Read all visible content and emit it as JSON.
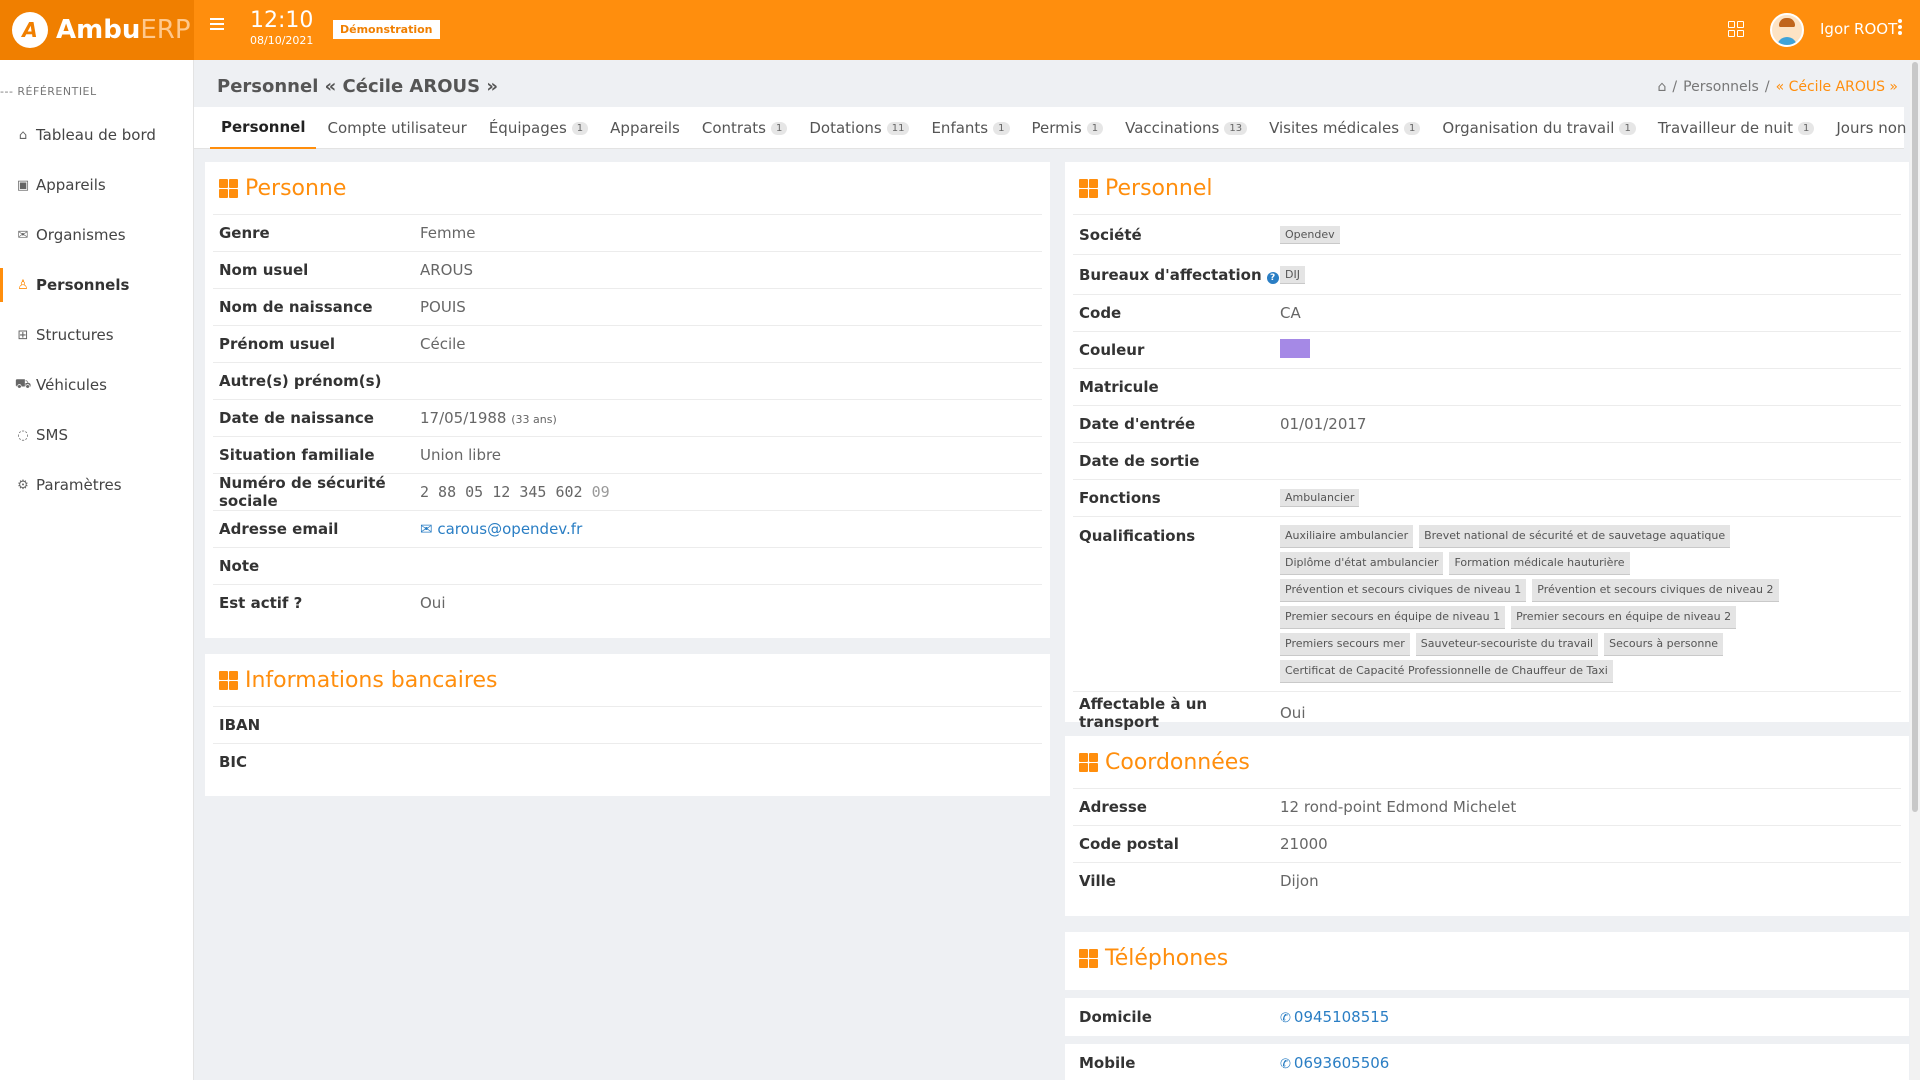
{
  "app": {
    "logo_letter": "A",
    "logo_bold": "Ambu",
    "logo_light": "ERP",
    "time": "12:10",
    "date": "08/10/2021",
    "demo_badge": "Démonstration",
    "user_name": "Igor ROOT",
    "accent_color": "#ff8e0d"
  },
  "sidebar": {
    "heading": "--- RÉFÉRENTIEL",
    "items": [
      {
        "label": "Tableau de bord",
        "icon": "home-icon"
      },
      {
        "label": "Appareils",
        "icon": "device-icon"
      },
      {
        "label": "Organismes",
        "icon": "inbox-icon"
      },
      {
        "label": "Personnels",
        "icon": "people-icon"
      },
      {
        "label": "Structures",
        "icon": "sitemap-icon"
      },
      {
        "label": "Véhicules",
        "icon": "car-icon"
      },
      {
        "label": "SMS",
        "icon": "chat-icon"
      },
      {
        "label": "Paramètres",
        "icon": "gear-icon"
      }
    ]
  },
  "page": {
    "title": "Personnel « Cécile AROUS »",
    "breadcrumb": [
      "Personnels",
      "/",
      "« Cécile AROUS »"
    ]
  },
  "tabs": [
    {
      "label": "Personnel",
      "count": ""
    },
    {
      "label": "Compte utilisateur",
      "count": ""
    },
    {
      "label": "Équipages",
      "count": "1"
    },
    {
      "label": "Appareils",
      "count": ""
    },
    {
      "label": "Contrats",
      "count": "1"
    },
    {
      "label": "Dotations",
      "count": "11"
    },
    {
      "label": "Enfants",
      "count": "1"
    },
    {
      "label": "Permis",
      "count": "1"
    },
    {
      "label": "Vaccinations",
      "count": "13"
    },
    {
      "label": "Visites médicales",
      "count": "1"
    },
    {
      "label": "Organisation du travail",
      "count": "1"
    },
    {
      "label": "Travailleur de nuit",
      "count": "1"
    },
    {
      "label": "Jours non travaillés",
      "count": ""
    }
  ],
  "personne": {
    "title": "Personne",
    "rows": [
      {
        "label": "Genre",
        "value": "Femme"
      },
      {
        "label": "Nom usuel",
        "value": "AROUS"
      },
      {
        "label": "Nom de naissance",
        "value": "POUIS"
      },
      {
        "label": "Prénom usuel",
        "value": "Cécile"
      },
      {
        "label": "Autre(s) prénom(s)",
        "value": ""
      },
      {
        "label": "Date de naissance",
        "value": "17/05/1988",
        "extra": "(33 ans)"
      },
      {
        "label": "Situation familiale",
        "value": "Union libre"
      },
      {
        "label": "Numéro de sécurité sociale",
        "value": "2 88 05 12 345 602",
        "extra": "09"
      },
      {
        "label": "Adresse email",
        "value": "carous@opendev.fr"
      },
      {
        "label": "Note",
        "value": ""
      },
      {
        "label": "Est actif ?",
        "value": "Oui"
      }
    ]
  },
  "banque": {
    "title": "Informations bancaires",
    "rows": [
      {
        "label": "IBAN",
        "value": ""
      },
      {
        "label": "BIC",
        "value": ""
      }
    ]
  },
  "personnel": {
    "title": "Personnel",
    "societe_label": "Société",
    "societe": "Opendev",
    "bureaux_label": "Bureaux d'affectation",
    "bureaux": "DIJ",
    "code_label": "Code",
    "code": "CA",
    "couleur_label": "Couleur",
    "couleur": "#a589e6",
    "matricule_label": "Matricule",
    "matricule": "",
    "entree_label": "Date d'entrée",
    "entree": "01/01/2017",
    "sortie_label": "Date de sortie",
    "sortie": "",
    "fonctions_label": "Fonctions",
    "fonctions": [
      "Ambulancier"
    ],
    "qualifications_label": "Qualifications",
    "qualifications": [
      "Auxiliaire ambulancier",
      "Brevet national de sécurité et de sauvetage aquatique",
      "Diplôme d'état ambulancier",
      "Formation médicale hauturière",
      "Prévention et secours civiques de niveau 1",
      "Prévention et secours civiques de niveau 2",
      "Premier secours en équipe de niveau 1",
      "Premier secours en équipe de niveau 2",
      "Premiers secours mer",
      "Sauveteur-secouriste du travail",
      "Secours à personne",
      "Certificat de Capacité Professionnelle de Chauffeur de Taxi"
    ],
    "affectable_label": "Affectable à un transport",
    "affectable": "Oui"
  },
  "coordonnees": {
    "title": "Coordonnées",
    "rows": [
      {
        "label": "Adresse",
        "value": "12 rond-point Edmond Michelet"
      },
      {
        "label": "Code postal",
        "value": "21000"
      },
      {
        "label": "Ville",
        "value": "Dijon"
      }
    ]
  },
  "telephones": {
    "title": "Téléphones",
    "rows": [
      {
        "label": "Domicile",
        "value": "0945108515"
      },
      {
        "label": "Mobile",
        "value": "0693605506"
      }
    ]
  }
}
